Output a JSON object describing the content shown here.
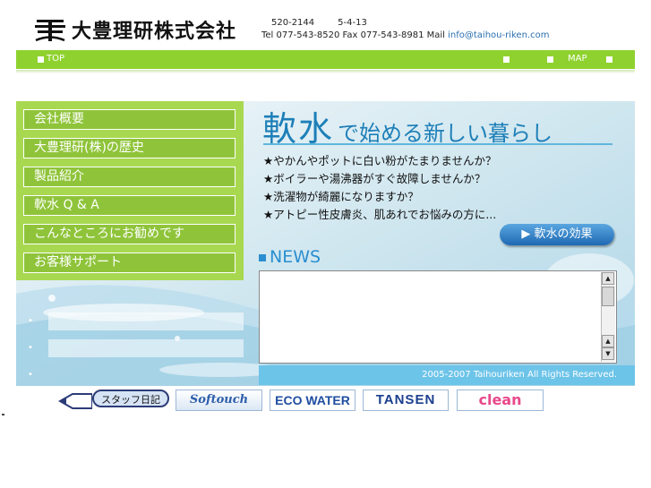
{
  "header": {
    "company_name": "大豊理研株式会社",
    "postal_code": "520-2144",
    "street": "5-4-13",
    "contact_prefix": "Tel 077-543-8520 Fax 077-543-8981 Mail ",
    "email": "info@taihou-riken.com"
  },
  "nav": {
    "top_label": "TOP",
    "map_label": "MAP"
  },
  "sidebar": {
    "items": [
      {
        "label": "会社概要"
      },
      {
        "label": "大豊理研(株)の歴史"
      },
      {
        "label": "製品紹介"
      },
      {
        "label": "軟水 Q & A"
      },
      {
        "label": "こんなところにお勧めです"
      },
      {
        "label": "お客様サポート"
      }
    ],
    "bullets": [
      "•",
      "•",
      "•"
    ]
  },
  "content": {
    "headline_big": "軟水",
    "headline_rest": "で始める新しい暮らし",
    "features": [
      "★やかんやポットに白い粉がたまりませんか？",
      "★ボイラーや湯沸器がすぐ故障しませんか？",
      "★洗濯物が綺麗になりますか？",
      "★アトピー性皮膚炎、肌あれでお悩みの方に..."
    ],
    "effect_button": "▶ 軟水の効果",
    "news_title": "NEWS",
    "copyright": "2005-2007 Taihouriken All Rights Reserved."
  },
  "banners": {
    "staff_diary": "スタッフ日記",
    "softouch": "Softouch",
    "ecowater": "ECO WATER",
    "tansen": "TANSEN",
    "clean": "clean"
  },
  "colors": {
    "nav_green": "#8fd22f",
    "sidebar_green": "#a8d850",
    "menu_green": "#8fc43a",
    "headline_blue": "#1d7fb8",
    "footer_blue": "#6dc4e9"
  }
}
